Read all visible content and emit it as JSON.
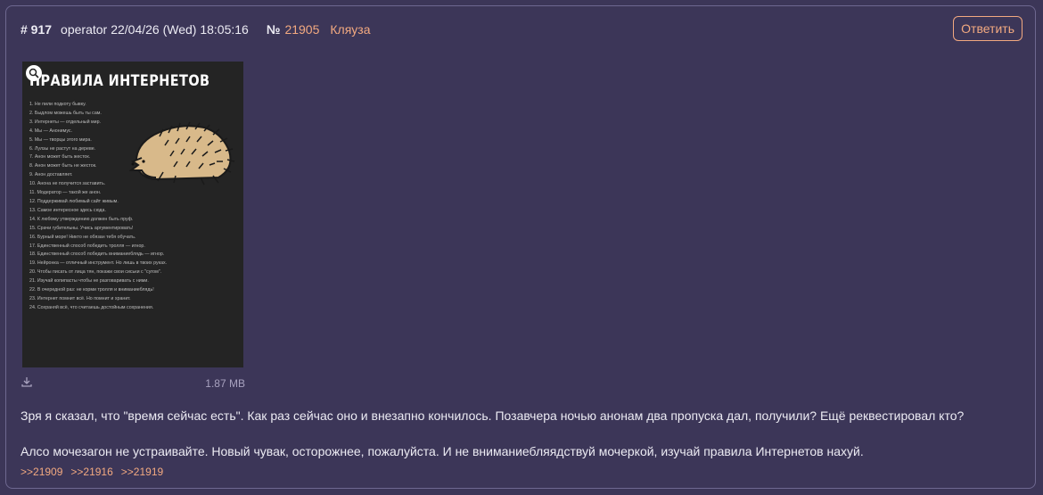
{
  "post": {
    "number": "# 917",
    "author": "operator",
    "datetime": "22/04/26 (Wed) 18:05:16",
    "num_label": "№",
    "ref_id": "21905",
    "ref_name": "Кляуза",
    "reply_label": "Ответить"
  },
  "image": {
    "title": "ПРАВИЛА ИНТЕРНЕТОВ",
    "size": "1.87 MB",
    "rules": [
      "1. Не пили подкоту бывку.",
      "2. Быдлом можешь быть ты сам.",
      "3. Интернеты — отдельный мир.",
      "4. Мы — Анонимус.",
      "5. Мы — творцы этого мира.",
      "6. Лулзы не растут на дереве.",
      "7. Анон может быть жесток.",
      "8. Анон может быть не жесток.",
      "9. Анон доставляет.",
      "10. Анона не получится заставить.",
      "11. Модератор — такой же анон.",
      "12. Поддерживай любимый сайт живым.",
      "13. Самое интересное здесь сюда.",
      "14. К любому утверждению должен быть пруф.",
      "15. Срачи губительны. Учись аргументировать!",
      "16. Бурный море! Никто не обязан тебя обучать.",
      "17. Единственный способ победить тролля — игнор.",
      "18. Единственный способ победить вниманиеблядь — игнор.",
      "19. Нейронка — отличный инструмент. Но лишь в твоих руках.",
      "20. Чтобы писать от лица тян, покажи свои сиськи с \"сугом\".",
      "21. Изучай копипасты чтобы не разговаривать с ними.",
      "22. В очередной раз: не корми тролля и вниманиеблядь!",
      "23. Интернет помнит всё. Но помнит и хранит.",
      "24. Сохраняй всё, что считаешь достойным сохранения."
    ]
  },
  "body": {
    "para1": "Зря я сказал, что \"время сейчас есть\". Как раз сейчас оно и внезапно кончилось. Позавчера ночью анонам два пропуска дал, получили? Ещё реквестировал кто?",
    "para2": "Алсо мочезагон не устраивайте. Новый чувак, осторожнее, пожалуйста. И не вниманиебляядствуй мочеркой, изучай правила Интернетов нахуй."
  },
  "replies": [
    ">>21909",
    ">>21916",
    ">>21919"
  ],
  "icons": {
    "zoom": "magnifier-icon",
    "download": "download-icon"
  },
  "colors": {
    "background": "#3c3658",
    "accent": "#f2a980",
    "border": "#6e6890"
  }
}
